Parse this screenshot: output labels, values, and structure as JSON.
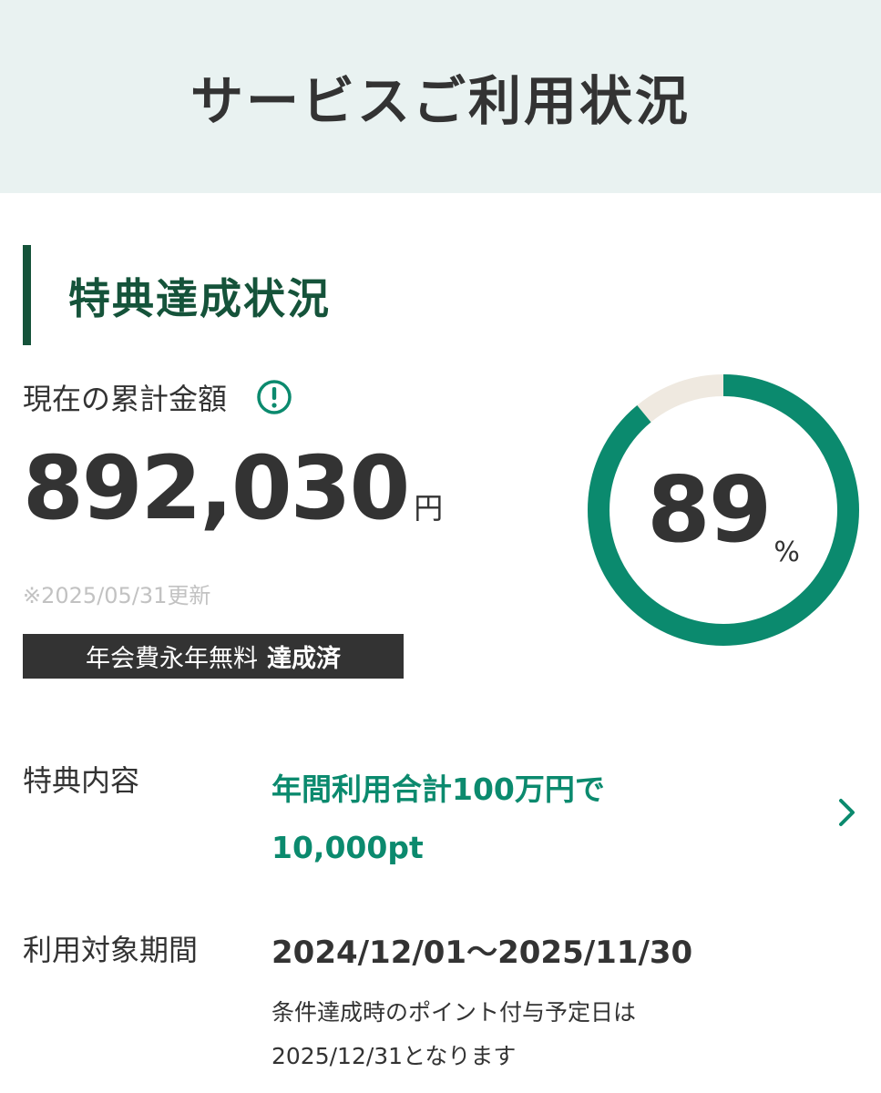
{
  "header": {
    "title": "サービスご利用状況"
  },
  "section": {
    "title": "特典達成状況"
  },
  "amount": {
    "label": "現在の累計金額",
    "value": "892,030",
    "unit": "円",
    "updated": "※2025/05/31更新",
    "info_icon": "exclamation-circle-icon"
  },
  "badge": {
    "text": "年会費永年無料",
    "status": "達成済"
  },
  "progress": {
    "percent_value": 89,
    "percent_text": "89",
    "unit": "%"
  },
  "benefit": {
    "label": "特典内容",
    "line1": "年間利用合計100万円で",
    "line2": "10,000pt",
    "chevron_icon": "chevron-right-icon"
  },
  "period": {
    "label": "利用対象期間",
    "value": "2024/12/01〜2025/11/30",
    "note_line1": "条件達成時のポイント付与予定日は",
    "note_line2": "2025/12/31となります"
  },
  "colors": {
    "header_bg": "#e9f2f1",
    "brand_dark_green": "#15533a",
    "accent_green": "#0b8a6e",
    "donut_track": "#efe9e0",
    "text": "#333333",
    "muted": "#c2c2c2",
    "badge_bg": "#333333"
  }
}
